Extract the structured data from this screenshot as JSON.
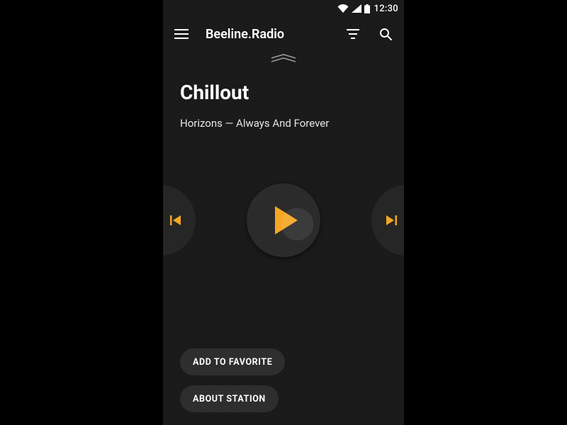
{
  "status": {
    "time": "12:30"
  },
  "appbar": {
    "title": "Beeline.Radio"
  },
  "player": {
    "station": "Chillout",
    "track": "Horizons — Always And Forever"
  },
  "buttons": {
    "favorite": "ADD TO FAVORITE",
    "about": "ABOUT STATION"
  },
  "colors": {
    "accent": "#f5a623"
  }
}
